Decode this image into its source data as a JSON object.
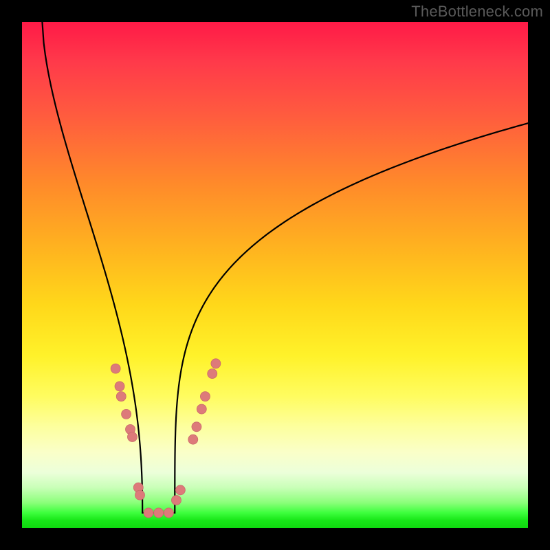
{
  "watermark": "TheBottleneck.com",
  "colors": {
    "curve_stroke": "#000000",
    "dot_fill": "#dd7a7a",
    "dot_stroke": "#c96a6a"
  },
  "chart_data": {
    "type": "line",
    "title": "",
    "xlabel": "",
    "ylabel": "",
    "xlim": [
      0,
      100
    ],
    "ylim": [
      0,
      100
    ],
    "curve": {
      "min_x": 27,
      "left_start_y": 100,
      "left_start_x": 4,
      "right_end_y": 80,
      "right_end_x": 100,
      "floor_y": 3,
      "floor_halfwidth": 3.2,
      "left_k": 0.0078,
      "right_k": 0.0035
    },
    "dots": [
      {
        "x": 18.5,
        "y": 31.5
      },
      {
        "x": 19.3,
        "y": 28.0
      },
      {
        "x": 19.6,
        "y": 26.0
      },
      {
        "x": 20.6,
        "y": 22.5
      },
      {
        "x": 21.4,
        "y": 19.5
      },
      {
        "x": 21.8,
        "y": 18.0
      },
      {
        "x": 23.0,
        "y": 8.0
      },
      {
        "x": 23.3,
        "y": 6.5
      },
      {
        "x": 25.0,
        "y": 3.0
      },
      {
        "x": 27.0,
        "y": 3.0
      },
      {
        "x": 29.0,
        "y": 3.0
      },
      {
        "x": 30.5,
        "y": 5.5
      },
      {
        "x": 31.3,
        "y": 7.5
      },
      {
        "x": 33.8,
        "y": 17.5
      },
      {
        "x": 34.5,
        "y": 20.0
      },
      {
        "x": 35.5,
        "y": 23.5
      },
      {
        "x": 36.2,
        "y": 26.0
      },
      {
        "x": 37.6,
        "y": 30.5
      },
      {
        "x": 38.3,
        "y": 32.5
      }
    ],
    "dot_radius_px": 7
  }
}
